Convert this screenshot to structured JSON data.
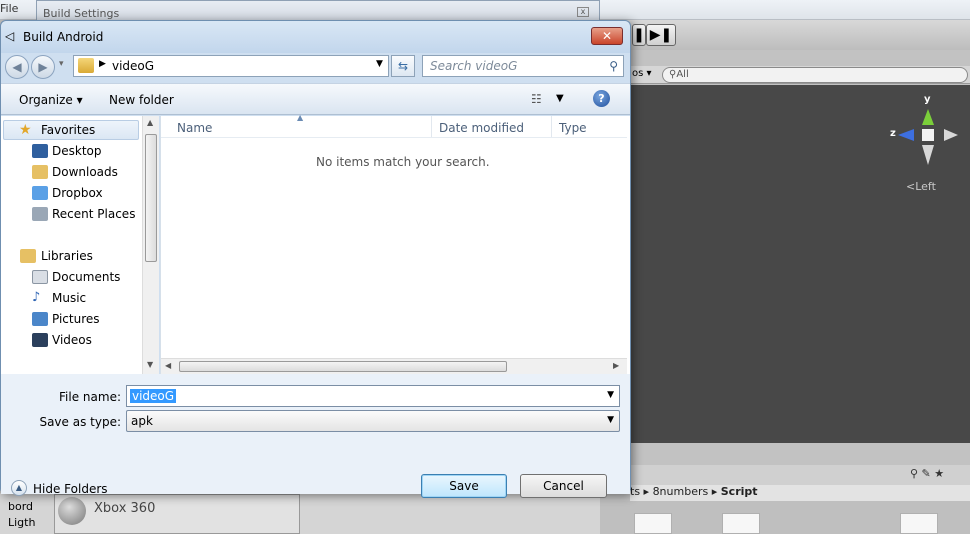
{
  "background": {
    "menu_file": "File",
    "build_settings_title": "Build Settings",
    "platform_item": "Xbox 360",
    "hierarchy_items": [
      "bord",
      "Ligth"
    ],
    "scene_search_placeholder": "All",
    "scene_left_tab": "os",
    "gizmo_axes": {
      "y": "y",
      "z": "z"
    },
    "gizmo_view_label": "Left",
    "breadcrumb": [
      "ts",
      "8numbers",
      "Script"
    ]
  },
  "dialog": {
    "title": "Build Android",
    "address_folder": "videoG",
    "search_placeholder": "Search videoG",
    "toolbar": {
      "organize": "Organize",
      "new_folder": "New folder"
    },
    "nav": {
      "favorites_header": "Favorites",
      "favorites": [
        "Desktop",
        "Downloads",
        "Dropbox",
        "Recent Places"
      ],
      "libraries_header": "Libraries",
      "libraries": [
        "Documents",
        "Music",
        "Pictures",
        "Videos"
      ]
    },
    "columns": [
      "Name",
      "Date modified",
      "Type"
    ],
    "empty_message": "No items match your search.",
    "file_name_label": "File name:",
    "file_name_value": "videoG",
    "save_type_label": "Save as type:",
    "save_type_value": "apk",
    "hide_folders": "Hide Folders",
    "save": "Save",
    "cancel": "Cancel"
  }
}
